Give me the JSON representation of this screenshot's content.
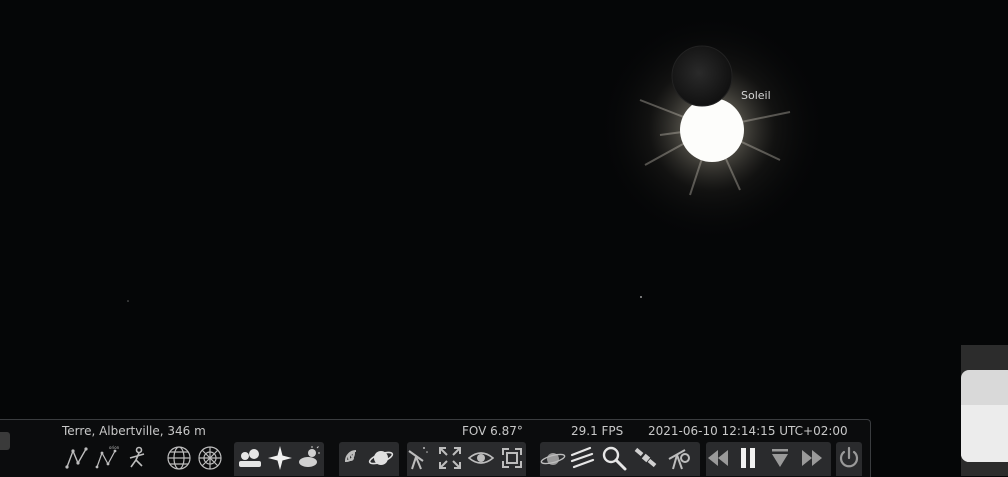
{
  "sky": {
    "sun_label": "Soleil",
    "colors": {
      "background": "#050607",
      "corona": "#f2efe6",
      "moon": "#141414"
    }
  },
  "status_bar": {
    "location": "Terre, Albertville, 346 m",
    "fov": "FOV 6.87°",
    "fps": "29.1 FPS",
    "datetime": "2021-06-10 12:14:15 UTC+02:00"
  },
  "toolbar": {
    "buttons": [
      "constellation-lines-icon",
      "constellation-labels-icon",
      "constellation-art-icon",
      "equatorial-grid-icon",
      "azimuthal-grid-icon",
      "ground-icon",
      "cardinal-points-icon",
      "atmosphere-icon",
      "nebulae-icon",
      "planet-labels-icon",
      "equatorial-mount-icon",
      "center-on-object-icon",
      "night-mode-icon",
      "fullscreen-icon",
      "exoplanets-icon",
      "meteor-showers-icon",
      "search-icon",
      "satellites-icon",
      "telescope-icon",
      "rewind-icon",
      "pause-icon",
      "real-time-icon",
      "fast-forward-icon",
      "quit-icon"
    ],
    "icon_color": "#bdbdbd",
    "group_color": "#2a2b2d"
  }
}
